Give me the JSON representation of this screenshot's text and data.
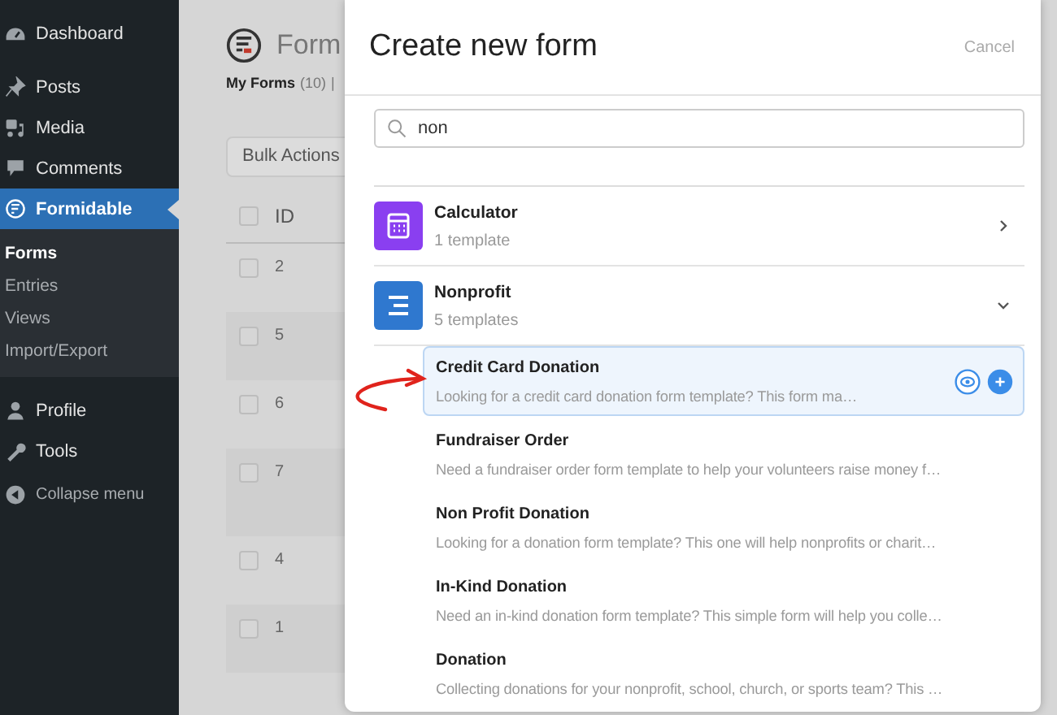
{
  "sidebar": {
    "items": [
      {
        "label": "Dashboard",
        "kind": "menu",
        "selected": false
      },
      {
        "label": "Posts",
        "kind": "menu",
        "selected": false
      },
      {
        "label": "Media",
        "kind": "menu",
        "selected": false
      },
      {
        "label": "Comments",
        "kind": "menu",
        "selected": false
      },
      {
        "label": "Formidable",
        "kind": "menu",
        "selected": true,
        "children": [
          {
            "label": "Forms",
            "selected": true
          },
          {
            "label": "Entries",
            "selected": false
          },
          {
            "label": "Views",
            "selected": false
          },
          {
            "label": "Import/Export",
            "selected": false
          }
        ]
      },
      {
        "label": "Profile",
        "kind": "menu",
        "selected": false
      },
      {
        "label": "Tools",
        "kind": "menu",
        "selected": false
      },
      {
        "label": "Collapse menu",
        "kind": "action"
      }
    ]
  },
  "page": {
    "title": "Form",
    "filter": "My Forms",
    "filter_count": "(10)",
    "separator": "|",
    "bulk_actions": "Bulk Actions",
    "table": {
      "columns": [
        "ID"
      ],
      "header_checked": false,
      "rows": [
        {
          "id": "2",
          "checked": false
        },
        {
          "id": "5",
          "checked": false
        },
        {
          "id": "6",
          "checked": false
        },
        {
          "id": "7",
          "checked": false
        },
        {
          "id": "4",
          "checked": false
        },
        {
          "id": "1",
          "checked": false
        }
      ]
    }
  },
  "modal": {
    "title": "Create new form",
    "cancel": "Cancel",
    "search": {
      "value": "non"
    },
    "categories": [
      {
        "name": "Calculator",
        "count": "1 template",
        "color": "#8a3ff0",
        "expanded": false
      },
      {
        "name": "Nonprofit",
        "count": "5 templates",
        "color": "#2f78cf",
        "expanded": true,
        "templates": [
          {
            "name": "Credit Card Donation",
            "description": "Looking for a credit card donation form template? This form ma…",
            "selected": true
          },
          {
            "name": "Fundraiser Order",
            "description": "Need a fundraiser order form template to help your volunteers raise money f…",
            "selected": false
          },
          {
            "name": "Non Profit Donation",
            "description": "Looking for a donation form template? This one will help nonprofits or charit…",
            "selected": false
          },
          {
            "name": "In-Kind Donation",
            "description": "Need an in-kind donation form template? This simple form will help you colle…",
            "selected": false
          },
          {
            "name": "Donation",
            "description": "Collecting donations for your nonprofit, school, church, or sports team? This …",
            "selected": false
          }
        ]
      }
    ]
  }
}
